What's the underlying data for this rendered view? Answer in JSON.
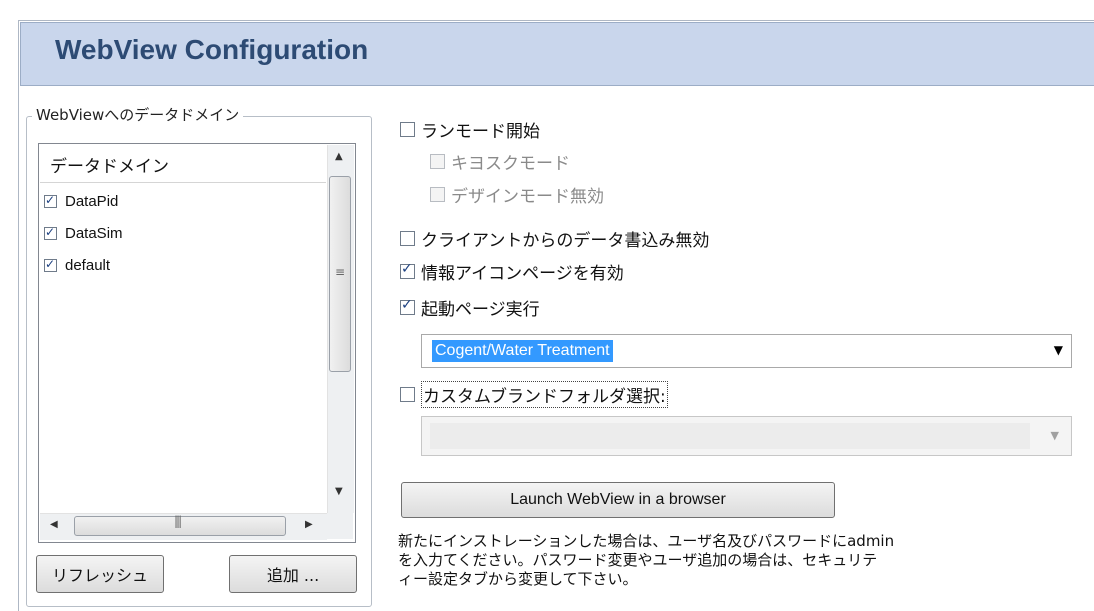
{
  "header": {
    "title": "WebView Configuration"
  },
  "domains": {
    "group_title": "WebViewへのデータドメイン",
    "column_header": "データドメイン",
    "items": [
      {
        "label": "DataPid",
        "checked": true
      },
      {
        "label": "DataSim",
        "checked": true
      },
      {
        "label": "default",
        "checked": true
      }
    ],
    "refresh_label": "リフレッシュ",
    "add_label": "追加 ..."
  },
  "options": {
    "run_mode": {
      "label": "ランモード開始",
      "checked": false
    },
    "kiosk_mode": {
      "label": "キヨスクモード",
      "checked": false,
      "enabled": false
    },
    "disable_design_mode": {
      "label": "デザインモード無効",
      "checked": false,
      "enabled": false
    },
    "disable_client_writes": {
      "label": "クライアントからのデータ書込み無効",
      "checked": false
    },
    "enable_info_icon_page": {
      "label": "情報アイコンページを有効",
      "checked": true
    },
    "run_startup_page": {
      "label": "起動ページ実行",
      "checked": true
    },
    "startup_page_value": "Cogent/Water Treatment",
    "custom_brand_folder": {
      "label": "カスタムブランドフォルダ選択:",
      "checked": false
    },
    "brand_folder_value": ""
  },
  "launch_button": "Launch WebView in a browser",
  "note": {
    "line1": "新たにインストレーションした場合は、ユーザ名及びパスワードにadmin",
    "line2": "を入力てください。パスワード変更やユーザ追加の場合は、セキュリテ",
    "line3": "ィー設定タブから変更して下さい。"
  }
}
